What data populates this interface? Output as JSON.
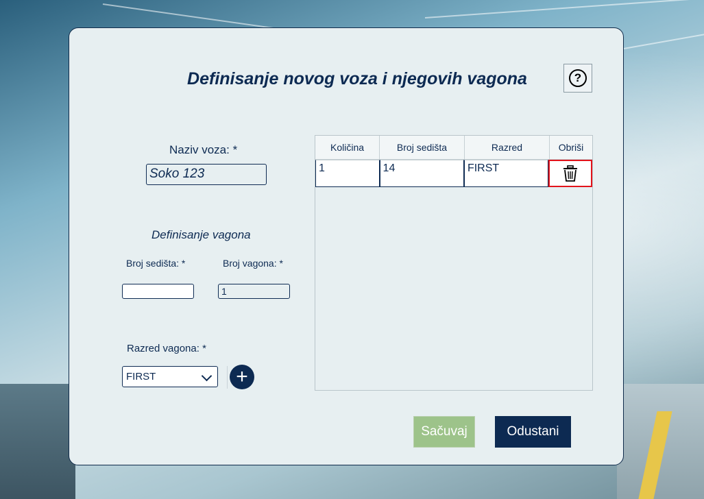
{
  "window": {
    "title": "Definisanje novog voza i njegovih vagona",
    "help_symbol": "?"
  },
  "train": {
    "name_label": "Naziv voza: *",
    "name_value": "Soko 123"
  },
  "wagon_section": {
    "heading": "Definisanje vagona",
    "seats_label": "Broj sedišta: *",
    "seats_value": "",
    "wagons_label": "Broj vagona: *",
    "wagons_value": "1",
    "class_label": "Razred vagona: *",
    "class_selected": "FIRST",
    "add_symbol": "+"
  },
  "table": {
    "columns": [
      "Količina",
      "Broj sedišta",
      "Razred",
      "Obriši"
    ],
    "rows": [
      {
        "kolicina": "1",
        "broj_sedista": "14",
        "razred": "FIRST"
      }
    ]
  },
  "actions": {
    "save_label": "Sačuvaj",
    "cancel_label": "Odustani"
  },
  "colors": {
    "accent": "#0d2a52",
    "save": "#9dc38a",
    "delete_highlight": "#e3131b"
  }
}
